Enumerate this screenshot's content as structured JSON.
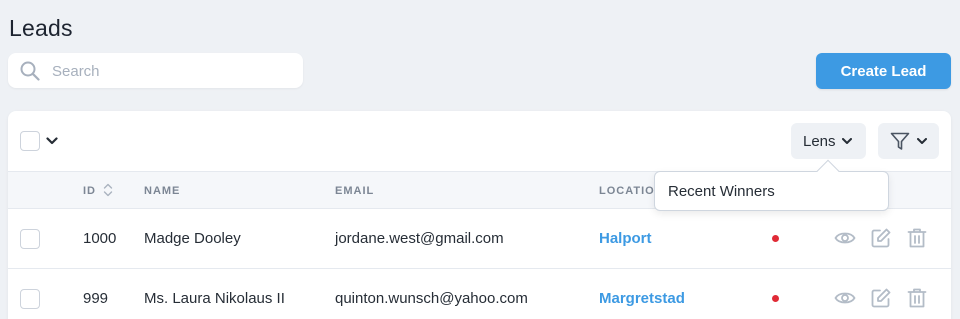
{
  "page": {
    "title": "Leads"
  },
  "search": {
    "placeholder": "Search",
    "value": ""
  },
  "actions": {
    "create_label": "Create Lead"
  },
  "toolbar": {
    "lens_label": "Lens"
  },
  "lens_menu": {
    "items": [
      "Recent Winners"
    ]
  },
  "table": {
    "columns": [
      "ID",
      "NAME",
      "EMAIL",
      "LOCATION"
    ],
    "rows": [
      {
        "id": "1000",
        "name": "Madge Dooley",
        "email": "jordane.west@gmail.com",
        "location": "Halport",
        "status_color": "#e02b36"
      },
      {
        "id": "999",
        "name": "Ms. Laura Nikolaus II",
        "email": "quinton.wunsch@yahoo.com",
        "location": "Margretstad",
        "status_color": "#e02b36"
      }
    ]
  },
  "icons": {
    "search": "search-icon",
    "select_caret": "chevron-down-icon",
    "filter": "funnel-icon",
    "sort": "sort-icon",
    "view": "eye-icon",
    "edit": "edit-icon",
    "delete": "trash-icon"
  },
  "colors": {
    "accent": "#3d9ae3",
    "background": "#eef1f5",
    "status_dot": "#e02b36",
    "muted_icon": "#b3bcc7"
  }
}
